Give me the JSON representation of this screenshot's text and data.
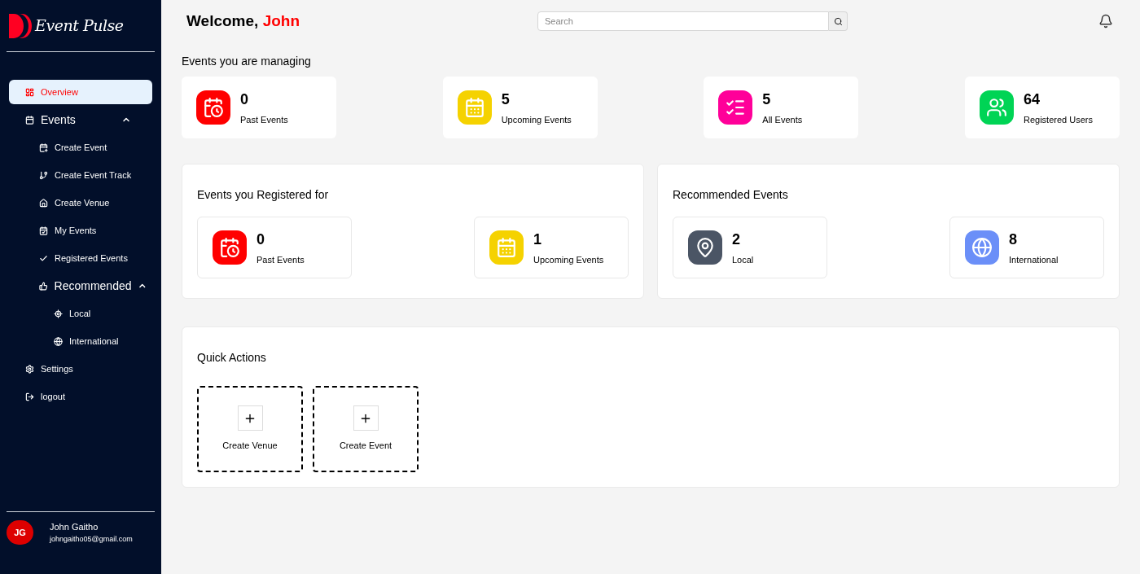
{
  "brand": {
    "name": "Event Pulse"
  },
  "sidebar": {
    "items": [
      {
        "label": "Overview",
        "selected": true
      },
      {
        "label": "Events",
        "selected": false,
        "expanded": true,
        "children": [
          {
            "label": "Create Event",
            "selected": false
          },
          {
            "label": "Create Event Track",
            "selected": false
          },
          {
            "label": "Create Venue",
            "selected": false
          },
          {
            "label": "My Events",
            "selected": false
          },
          {
            "label": "Registered Events",
            "selected": false
          },
          {
            "label": "Recommended",
            "selected": false,
            "expanded": true,
            "children": [
              {
                "label": "Local",
                "selected": false
              },
              {
                "label": "International",
                "selected": false
              }
            ]
          }
        ]
      },
      {
        "label": "Settings",
        "selected": false
      },
      {
        "label": "logout",
        "selected": false
      }
    ]
  },
  "user": {
    "initials": "JG",
    "name": "John Gaitho",
    "email": "johngaitho05@gmail.com"
  },
  "header": {
    "greeting": "Welcome,",
    "name": "John",
    "search": {
      "placeholder": "Search"
    }
  },
  "managing": {
    "title": "Events you are managing",
    "stats": [
      {
        "kind": "past",
        "value": "0",
        "label": "Past Events",
        "color": "#ff0000"
      },
      {
        "kind": "upcoming",
        "value": "5",
        "label": "Upcoming Events",
        "color": "#f5d200"
      },
      {
        "kind": "all",
        "value": "5",
        "label": "All Events",
        "color": "#ff0099"
      },
      {
        "kind": "users",
        "value": "64",
        "label": "Registered Users",
        "color": "#00d455"
      }
    ]
  },
  "registered": {
    "title": "Events you Registered for",
    "stats": [
      {
        "kind": "past",
        "value": "0",
        "label": "Past Events",
        "color": "#ff0000"
      },
      {
        "kind": "upcoming",
        "value": "1",
        "label": "Upcoming Events",
        "color": "#f5d200"
      }
    ]
  },
  "recommended": {
    "title": "Recommended Events",
    "stats": [
      {
        "kind": "local",
        "value": "2",
        "label": "Local",
        "color": "#4b5565"
      },
      {
        "kind": "international",
        "value": "8",
        "label": "International",
        "color": "#6b8ff8"
      }
    ]
  },
  "quick_actions": {
    "title": "Quick Actions",
    "actions": [
      {
        "label": "Create Venue"
      },
      {
        "label": "Create Event"
      }
    ]
  }
}
